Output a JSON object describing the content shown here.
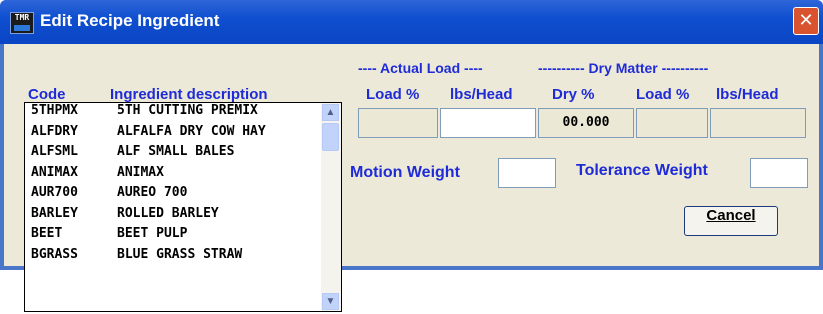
{
  "window": {
    "title": "Edit Recipe Ingredient",
    "icon_text": "TMR"
  },
  "headers": {
    "actual_load": "---- Actual Load ----",
    "dry_matter": "----------  Dry  Matter  ----------",
    "code": "Code",
    "ingredient_description": "Ingredient description",
    "load_pct": "Load %",
    "lbs_head": "lbs/Head",
    "dry_pct": "Dry %",
    "dm_load_pct": "Load %",
    "dm_lbs_head": "lbs/Head"
  },
  "fields": {
    "code_combo_value": "",
    "dry_pct_value": "00.000",
    "motion_weight_label": "Motion Weight",
    "tolerance_weight_label": "Tolerance Weight"
  },
  "list_items": [
    {
      "code": "5THPMX",
      "desc": "5TH CUTTING PREMIX"
    },
    {
      "code": "ALFDRY",
      "desc": "ALFALFA DRY COW HAY"
    },
    {
      "code": "ALFSML",
      "desc": "ALF SMALL BALES"
    },
    {
      "code": "ANIMAX",
      "desc": "ANIMAX"
    },
    {
      "code": "AUR700",
      "desc": "AUREO 700"
    },
    {
      "code": "BARLEY",
      "desc": "ROLLED BARLEY"
    },
    {
      "code": "BEET",
      "desc": "BEET PULP"
    },
    {
      "code": "BGRASS",
      "desc": "BLUE GRASS STRAW"
    }
  ],
  "buttons": {
    "cancel": "Cancel"
  },
  "colors": {
    "label": "#1f2bd6",
    "titlebar": "#0a45c4",
    "client": "#ece9d8"
  },
  "icons": {
    "close": "close-icon",
    "dropdown": "chevron-down-icon",
    "scroll_up": "chevron-up-icon",
    "scroll_down": "chevron-down-icon"
  }
}
